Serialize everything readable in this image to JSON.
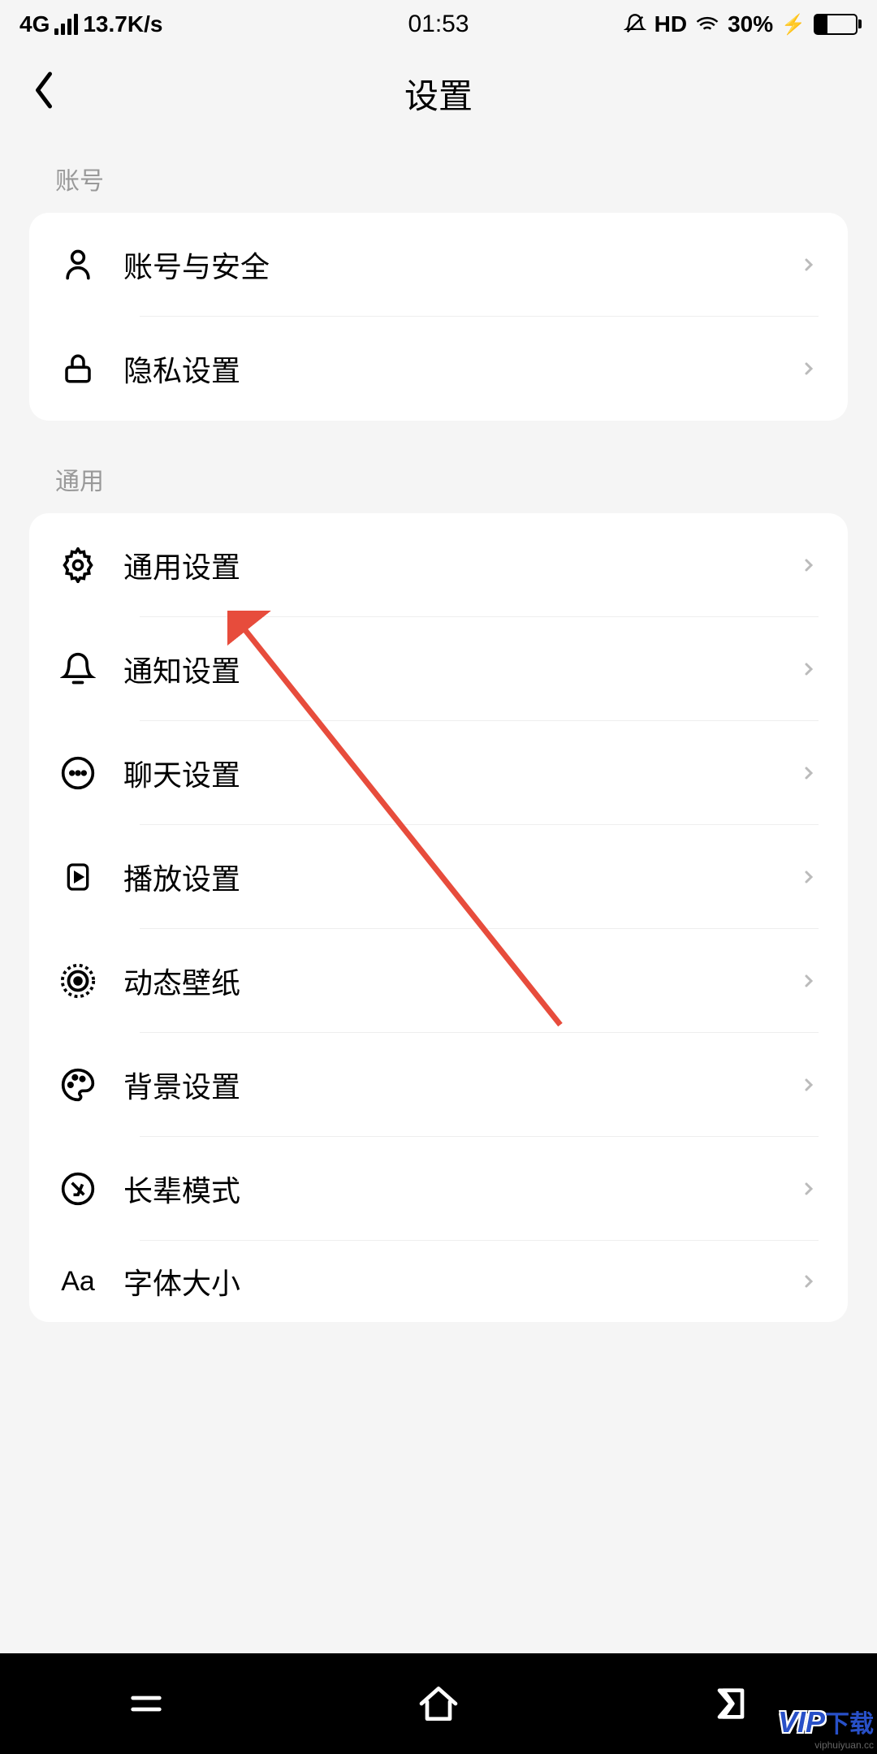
{
  "status": {
    "network": "4G",
    "speed": "13.7K/s",
    "time": "01:53",
    "hd": "HD",
    "battery": "30%"
  },
  "header": {
    "title": "设置"
  },
  "sections": [
    {
      "title": "账号",
      "items": [
        {
          "label": "账号与安全",
          "icon": "person-icon"
        },
        {
          "label": "隐私设置",
          "icon": "lock-icon"
        }
      ]
    },
    {
      "title": "通用",
      "items": [
        {
          "label": "通用设置",
          "icon": "gear-icon"
        },
        {
          "label": "通知设置",
          "icon": "bell-icon"
        },
        {
          "label": "聊天设置",
          "icon": "chat-icon"
        },
        {
          "label": "播放设置",
          "icon": "play-icon"
        },
        {
          "label": "动态壁纸",
          "icon": "wallpaper-icon"
        },
        {
          "label": "背景设置",
          "icon": "palette-icon"
        },
        {
          "label": "长辈模式",
          "icon": "accessibility-icon"
        },
        {
          "label": "字体大小",
          "icon": "font-icon"
        }
      ]
    }
  ],
  "watermark": {
    "brand": "VIP",
    "text": "下载",
    "url": "viphuiyuan.cc"
  }
}
